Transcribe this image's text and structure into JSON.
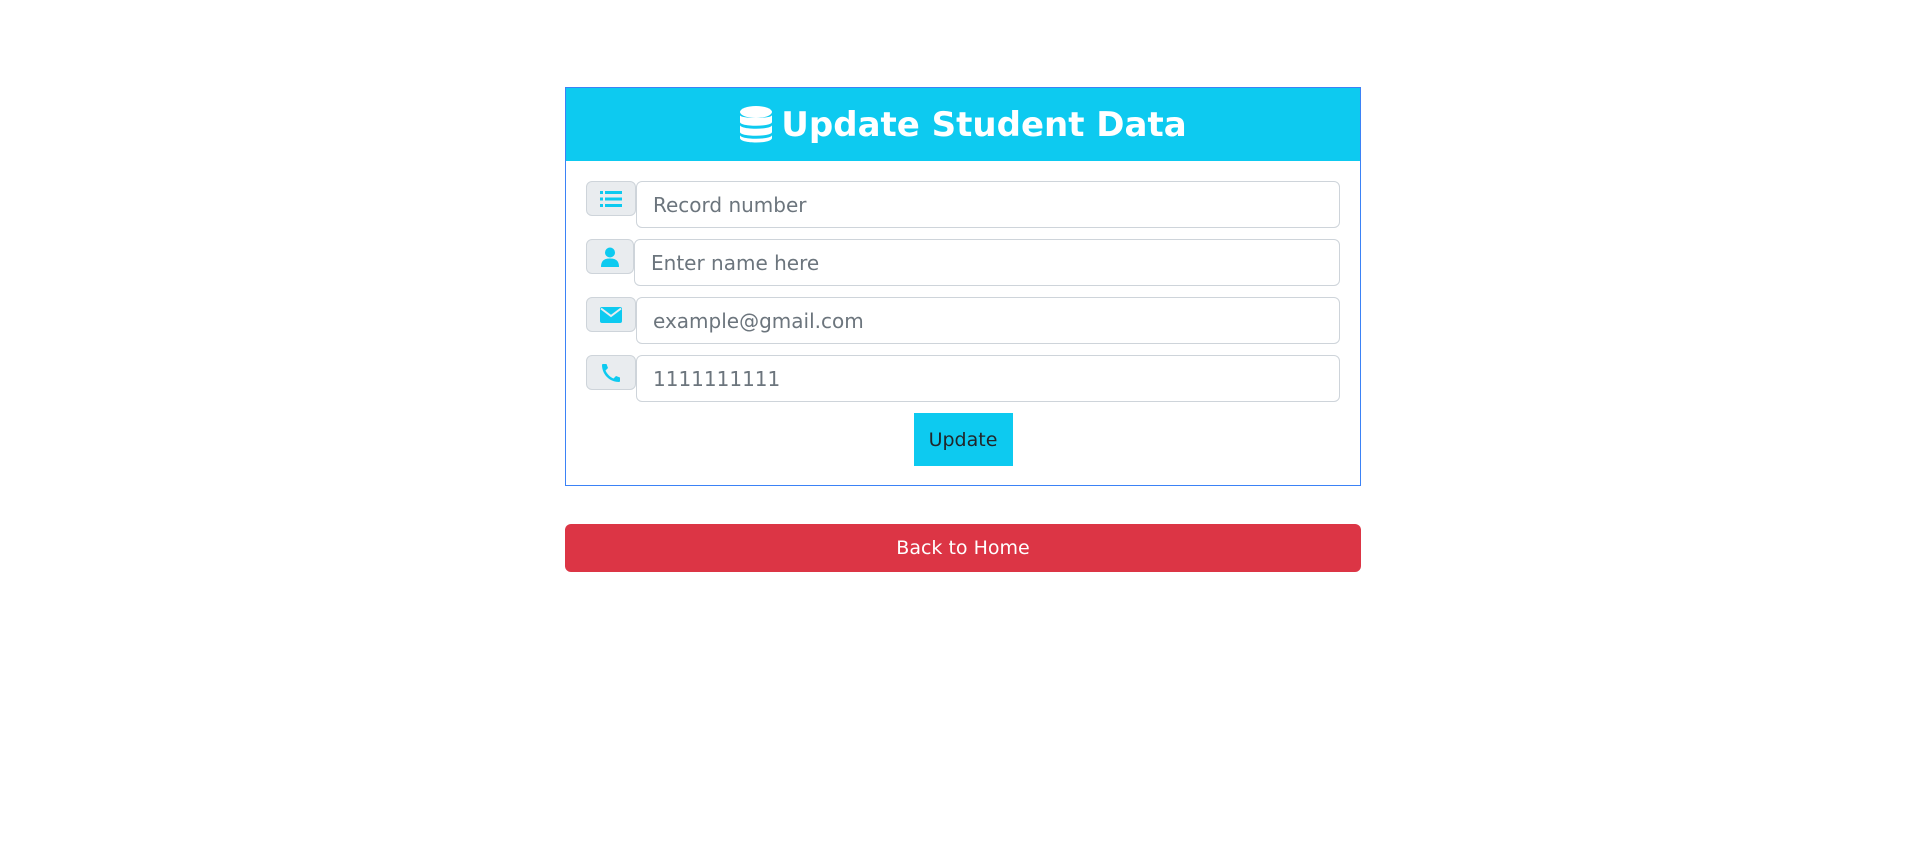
{
  "header": {
    "title": "Update Student Data",
    "icon": "database-icon"
  },
  "form": {
    "fields": [
      {
        "icon": "list-icon",
        "placeholder": "Record number",
        "value": ""
      },
      {
        "icon": "user-icon",
        "placeholder": "Enter name here",
        "value": ""
      },
      {
        "icon": "envelope-icon",
        "placeholder": "example@gmail.com",
        "value": ""
      },
      {
        "icon": "phone-icon",
        "placeholder": "1111111111",
        "value": ""
      }
    ],
    "update_label": "Update"
  },
  "home_label": "Back to Home",
  "colors": {
    "accent": "#0dcaf0",
    "danger": "#dc3545",
    "card_border": "#3b82f6"
  }
}
